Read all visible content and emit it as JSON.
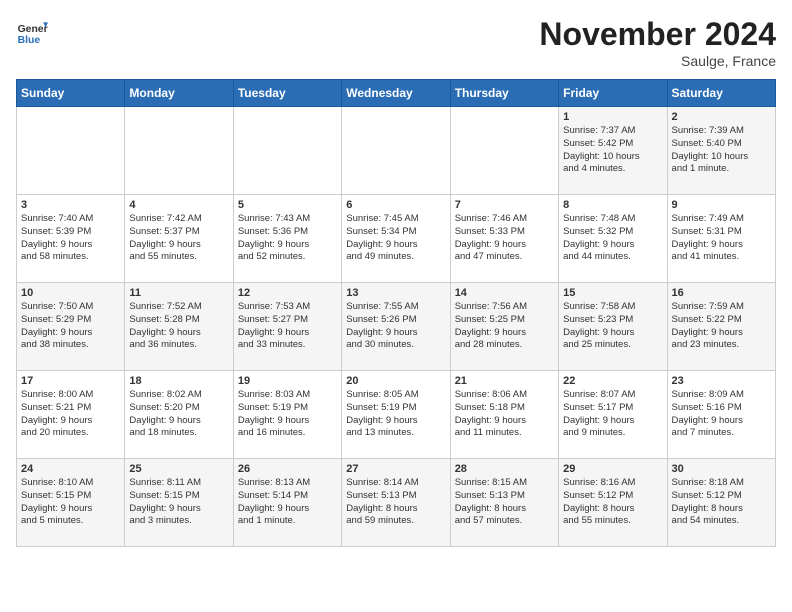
{
  "header": {
    "logo_line1": "General",
    "logo_line2": "Blue",
    "month": "November 2024",
    "location": "Saulge, France"
  },
  "days_of_week": [
    "Sunday",
    "Monday",
    "Tuesday",
    "Wednesday",
    "Thursday",
    "Friday",
    "Saturday"
  ],
  "weeks": [
    [
      {
        "day": "",
        "info": ""
      },
      {
        "day": "",
        "info": ""
      },
      {
        "day": "",
        "info": ""
      },
      {
        "day": "",
        "info": ""
      },
      {
        "day": "",
        "info": ""
      },
      {
        "day": "1",
        "info": "Sunrise: 7:37 AM\nSunset: 5:42 PM\nDaylight: 10 hours\nand 4 minutes."
      },
      {
        "day": "2",
        "info": "Sunrise: 7:39 AM\nSunset: 5:40 PM\nDaylight: 10 hours\nand 1 minute."
      }
    ],
    [
      {
        "day": "3",
        "info": "Sunrise: 7:40 AM\nSunset: 5:39 PM\nDaylight: 9 hours\nand 58 minutes."
      },
      {
        "day": "4",
        "info": "Sunrise: 7:42 AM\nSunset: 5:37 PM\nDaylight: 9 hours\nand 55 minutes."
      },
      {
        "day": "5",
        "info": "Sunrise: 7:43 AM\nSunset: 5:36 PM\nDaylight: 9 hours\nand 52 minutes."
      },
      {
        "day": "6",
        "info": "Sunrise: 7:45 AM\nSunset: 5:34 PM\nDaylight: 9 hours\nand 49 minutes."
      },
      {
        "day": "7",
        "info": "Sunrise: 7:46 AM\nSunset: 5:33 PM\nDaylight: 9 hours\nand 47 minutes."
      },
      {
        "day": "8",
        "info": "Sunrise: 7:48 AM\nSunset: 5:32 PM\nDaylight: 9 hours\nand 44 minutes."
      },
      {
        "day": "9",
        "info": "Sunrise: 7:49 AM\nSunset: 5:31 PM\nDaylight: 9 hours\nand 41 minutes."
      }
    ],
    [
      {
        "day": "10",
        "info": "Sunrise: 7:50 AM\nSunset: 5:29 PM\nDaylight: 9 hours\nand 38 minutes."
      },
      {
        "day": "11",
        "info": "Sunrise: 7:52 AM\nSunset: 5:28 PM\nDaylight: 9 hours\nand 36 minutes."
      },
      {
        "day": "12",
        "info": "Sunrise: 7:53 AM\nSunset: 5:27 PM\nDaylight: 9 hours\nand 33 minutes."
      },
      {
        "day": "13",
        "info": "Sunrise: 7:55 AM\nSunset: 5:26 PM\nDaylight: 9 hours\nand 30 minutes."
      },
      {
        "day": "14",
        "info": "Sunrise: 7:56 AM\nSunset: 5:25 PM\nDaylight: 9 hours\nand 28 minutes."
      },
      {
        "day": "15",
        "info": "Sunrise: 7:58 AM\nSunset: 5:23 PM\nDaylight: 9 hours\nand 25 minutes."
      },
      {
        "day": "16",
        "info": "Sunrise: 7:59 AM\nSunset: 5:22 PM\nDaylight: 9 hours\nand 23 minutes."
      }
    ],
    [
      {
        "day": "17",
        "info": "Sunrise: 8:00 AM\nSunset: 5:21 PM\nDaylight: 9 hours\nand 20 minutes."
      },
      {
        "day": "18",
        "info": "Sunrise: 8:02 AM\nSunset: 5:20 PM\nDaylight: 9 hours\nand 18 minutes."
      },
      {
        "day": "19",
        "info": "Sunrise: 8:03 AM\nSunset: 5:19 PM\nDaylight: 9 hours\nand 16 minutes."
      },
      {
        "day": "20",
        "info": "Sunrise: 8:05 AM\nSunset: 5:19 PM\nDaylight: 9 hours\nand 13 minutes."
      },
      {
        "day": "21",
        "info": "Sunrise: 8:06 AM\nSunset: 5:18 PM\nDaylight: 9 hours\nand 11 minutes."
      },
      {
        "day": "22",
        "info": "Sunrise: 8:07 AM\nSunset: 5:17 PM\nDaylight: 9 hours\nand 9 minutes."
      },
      {
        "day": "23",
        "info": "Sunrise: 8:09 AM\nSunset: 5:16 PM\nDaylight: 9 hours\nand 7 minutes."
      }
    ],
    [
      {
        "day": "24",
        "info": "Sunrise: 8:10 AM\nSunset: 5:15 PM\nDaylight: 9 hours\nand 5 minutes."
      },
      {
        "day": "25",
        "info": "Sunrise: 8:11 AM\nSunset: 5:15 PM\nDaylight: 9 hours\nand 3 minutes."
      },
      {
        "day": "26",
        "info": "Sunrise: 8:13 AM\nSunset: 5:14 PM\nDaylight: 9 hours\nand 1 minute."
      },
      {
        "day": "27",
        "info": "Sunrise: 8:14 AM\nSunset: 5:13 PM\nDaylight: 8 hours\nand 59 minutes."
      },
      {
        "day": "28",
        "info": "Sunrise: 8:15 AM\nSunset: 5:13 PM\nDaylight: 8 hours\nand 57 minutes."
      },
      {
        "day": "29",
        "info": "Sunrise: 8:16 AM\nSunset: 5:12 PM\nDaylight: 8 hours\nand 55 minutes."
      },
      {
        "day": "30",
        "info": "Sunrise: 8:18 AM\nSunset: 5:12 PM\nDaylight: 8 hours\nand 54 minutes."
      }
    ]
  ]
}
